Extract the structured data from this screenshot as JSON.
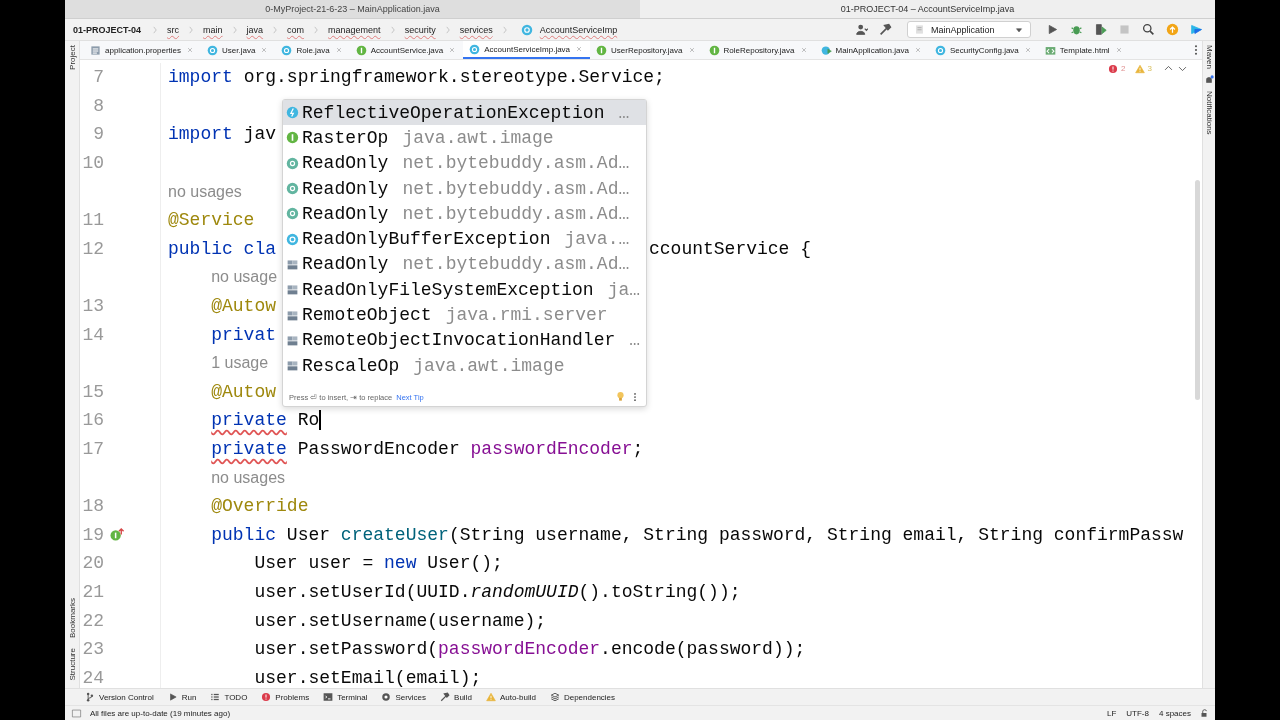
{
  "window_tabs": [
    {
      "title": "0-MyProject-21-6-23 – MainApplication.java",
      "selected": false
    },
    {
      "title": "01-PROJECT-04 – AccountServiceImp.java",
      "selected": true
    }
  ],
  "breadcrumbs": {
    "project": "01-PROJECT-04",
    "parts": [
      "src",
      "main",
      "java",
      "com",
      "management",
      "security",
      "services"
    ],
    "file": "AccountServiceImp"
  },
  "run_config": "MainApplication",
  "editor_tabs": [
    {
      "label": "application.properties",
      "kind": "properties",
      "selected": false
    },
    {
      "label": "User.java",
      "kind": "class",
      "selected": false
    },
    {
      "label": "Role.java",
      "kind": "class",
      "selected": false
    },
    {
      "label": "AccountService.java",
      "kind": "interface",
      "selected": false
    },
    {
      "label": "AccountServiceImp.java",
      "kind": "class",
      "selected": true
    },
    {
      "label": "UserRepository.java",
      "kind": "interface",
      "selected": false
    },
    {
      "label": "RoleRepository.java",
      "kind": "interface",
      "selected": false
    },
    {
      "label": "MainApplication.java",
      "kind": "main",
      "selected": false
    },
    {
      "label": "SecurityConfig.java",
      "kind": "class",
      "selected": false
    },
    {
      "label": "Template.html",
      "kind": "html",
      "selected": false
    }
  ],
  "left_strip": {
    "top": [
      "Project"
    ],
    "bottom": [
      "Bookmarks",
      "Structure"
    ]
  },
  "right_strip": [
    "Maven",
    "Notifications"
  ],
  "inspections": {
    "errors": "2",
    "warnings": "3"
  },
  "lines": [
    {
      "kind": "code",
      "number": "7",
      "tokens": [
        {
          "text": "import",
          "kind": "kw"
        },
        {
          "text": " org.springframework.stereotype.Service;",
          "kind": "plain"
        }
      ]
    },
    {
      "kind": "code",
      "number": "8"
    },
    {
      "kind": "code",
      "number": "9",
      "tokens": [
        {
          "text": "import",
          "kind": "kw"
        },
        {
          "text": " jav",
          "kind": "plain"
        }
      ]
    },
    {
      "kind": "code",
      "number": "10"
    },
    {
      "kind": "hint",
      "text": "no usages"
    },
    {
      "kind": "code",
      "number": "11",
      "tokens": [
        {
          "text": "@Service",
          "kind": "ann"
        }
      ]
    },
    {
      "kind": "code",
      "number": "12",
      "tokens": [
        {
          "text": "public cla",
          "kind": "kw"
        }
      ],
      "after_popup": [
        {
          "text": "ccountService {",
          "kind": "plain"
        }
      ]
    },
    {
      "kind": "hint",
      "text": "no usage"
    },
    {
      "kind": "code",
      "number": "13",
      "tokens": [
        {
          "text": "    @Autow",
          "kind": "ann"
        }
      ]
    },
    {
      "kind": "code",
      "number": "14",
      "tokens": [
        {
          "text": "    privat",
          "kind": "kw"
        }
      ]
    },
    {
      "kind": "hint",
      "text": "1 usage"
    },
    {
      "kind": "code",
      "number": "15",
      "tokens": [
        {
          "text": "    @Autow",
          "kind": "ann"
        }
      ]
    },
    {
      "kind": "code",
      "number": "16",
      "caret": true,
      "tokens": [
        {
          "text": "    private",
          "kind": "kw",
          "error": true
        },
        {
          "text": " Ro",
          "kind": "plain"
        }
      ]
    },
    {
      "kind": "code",
      "number": "17",
      "tokens": [
        {
          "text": "    private",
          "kind": "kw",
          "error": true
        },
        {
          "text": " PasswordEncoder ",
          "kind": "plain"
        },
        {
          "text": "passwordEncoder",
          "kind": "field"
        },
        {
          "text": ";",
          "kind": "plain"
        }
      ]
    },
    {
      "kind": "hint",
      "text": "no usages"
    },
    {
      "kind": "code",
      "number": "18",
      "tokens": [
        {
          "text": "    @Override",
          "kind": "ann"
        }
      ]
    },
    {
      "kind": "code",
      "number": "19",
      "gutter_marker": true,
      "tokens": [
        {
          "text": "    public",
          "kind": "kw"
        },
        {
          "text": " User ",
          "kind": "plain"
        },
        {
          "text": "createUser",
          "kind": "method"
        },
        {
          "text": "(String username, String password, String email, String confirmPassw",
          "kind": "plain"
        }
      ]
    },
    {
      "kind": "code",
      "number": "20",
      "tokens": [
        {
          "text": "        User user = ",
          "kind": "plain"
        },
        {
          "text": "new",
          "kind": "kw"
        },
        {
          "text": " User();",
          "kind": "plain"
        }
      ]
    },
    {
      "kind": "code",
      "number": "21",
      "tokens": [
        {
          "text": "        user.setUserId(UUID.",
          "kind": "plain"
        },
        {
          "text": "randomUUID",
          "kind": "static"
        },
        {
          "text": "().toString());",
          "kind": "plain"
        }
      ]
    },
    {
      "kind": "code",
      "number": "22",
      "tokens": [
        {
          "text": "        user.setUsername(username);",
          "kind": "plain"
        }
      ]
    },
    {
      "kind": "code",
      "number": "23",
      "tokens": [
        {
          "text": "        user.setPassword(",
          "kind": "plain"
        },
        {
          "text": "passwordEncoder",
          "kind": "field"
        },
        {
          "text": ".encode(password));",
          "kind": "plain"
        }
      ]
    },
    {
      "kind": "code",
      "number": "24",
      "tokens": [
        {
          "text": "        user.setEmail(email);",
          "kind": "plain"
        }
      ]
    }
  ],
  "completion": {
    "items": [
      {
        "name": "ReflectiveOperationException",
        "detail": "…",
        "kind": "exception",
        "selected": true
      },
      {
        "name": "RasterOp",
        "detail": "java.awt.image",
        "kind": "interface",
        "selected": false
      },
      {
        "name": "ReadOnly",
        "detail": "net.bytebuddy.asm.Ad…",
        "kind": "annotation",
        "selected": false
      },
      {
        "name": "ReadOnly",
        "detail": "net.bytebuddy.asm.Ad…",
        "kind": "annotation",
        "selected": false
      },
      {
        "name": "ReadOnly",
        "detail": "net.bytebuddy.asm.Ad…",
        "kind": "annotation",
        "selected": false
      },
      {
        "name": "ReadOnlyBufferException",
        "detail": "java.…",
        "kind": "class",
        "selected": false
      },
      {
        "name": "ReadOnly",
        "detail": "net.bytebuddy.asm.Ad…",
        "kind": "lib",
        "selected": false
      },
      {
        "name": "ReadOnlyFileSystemException",
        "detail": "ja…",
        "kind": "lib",
        "selected": false
      },
      {
        "name": "RemoteObject",
        "detail": "java.rmi.server",
        "kind": "lib",
        "selected": false
      },
      {
        "name": "RemoteObjectInvocationHandler",
        "detail": "…",
        "kind": "lib",
        "selected": false
      },
      {
        "name": "RescaleOp",
        "detail": "java.awt.image",
        "kind": "lib",
        "selected": false
      }
    ],
    "hint": "Press ⏎ to insert, ⇥ to replace",
    "tip_link": "Next Tip"
  },
  "tool_windows": [
    {
      "label": "Version Control",
      "kind": "vcs"
    },
    {
      "label": "Run",
      "kind": "run"
    },
    {
      "label": "TODO",
      "kind": "todo"
    },
    {
      "label": "Problems",
      "kind": "problems"
    },
    {
      "label": "Terminal",
      "kind": "terminal"
    },
    {
      "label": "Services",
      "kind": "services"
    },
    {
      "label": "Build",
      "kind": "build"
    },
    {
      "label": "Auto-build",
      "kind": "autobuild"
    },
    {
      "label": "Dependencies",
      "kind": "dependencies"
    }
  ],
  "status": {
    "message": "All files are up-to-date (19 minutes ago)",
    "right": [
      "LF",
      "UTF-8",
      "4 spaces"
    ]
  }
}
